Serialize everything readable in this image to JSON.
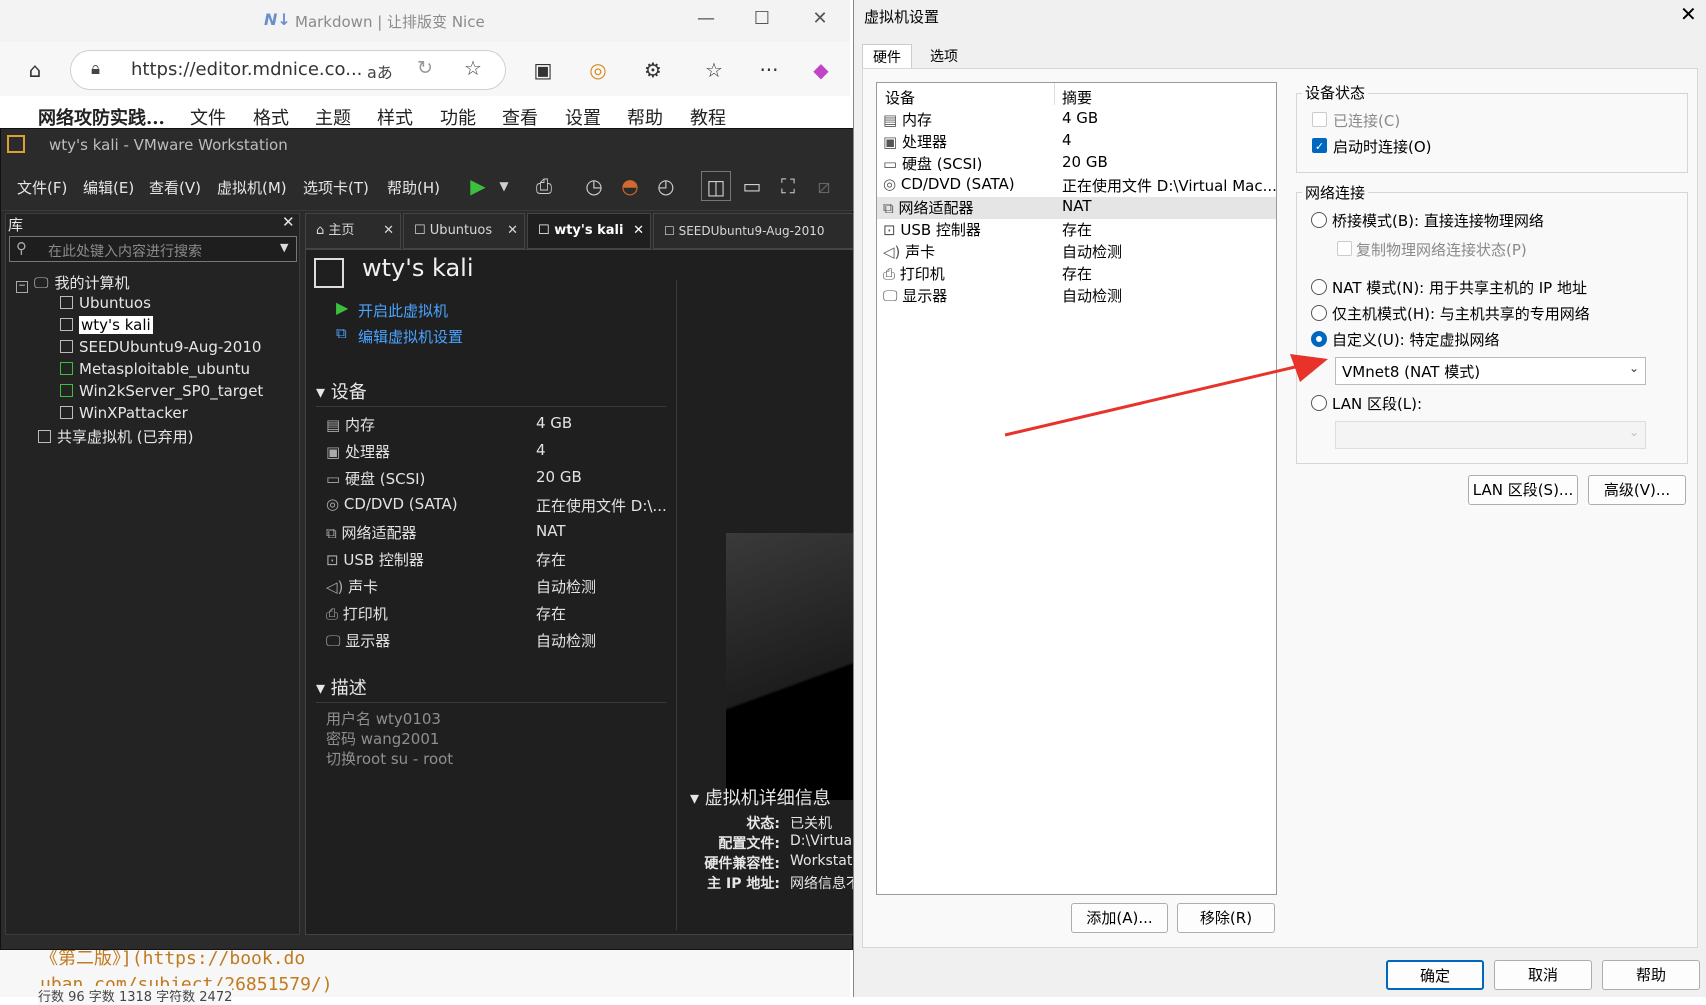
{
  "browser": {
    "title": "Markdown | 让排版变 Nice",
    "url": "https://editor.mdnice.co...",
    "menu": [
      "网络攻防实践...",
      "文件",
      "格式",
      "主题",
      "样式",
      "功能",
      "查看",
      "设置",
      "帮助",
      "教程"
    ],
    "bottom_line1": "《第二版》](https://book.do",
    "bottom_line2": "uban.com/subject/26851579/)",
    "statusbar": "行数 96  字数 1318  字符数 2472"
  },
  "vmware": {
    "title": "wty's kali - VMware Workstation",
    "menu": [
      "文件(F)",
      "编辑(E)",
      "查看(V)",
      "虚拟机(M)",
      "选项卡(T)",
      "帮助(H)"
    ],
    "library_title": "库",
    "search_placeholder": "在此处键入内容进行搜索",
    "tree": {
      "root": "我的计算机",
      "items": [
        "Ubuntuos",
        "wty's kali",
        "SEEDUbuntu9-Aug-2010",
        "Metasploitable_ubuntu",
        "Win2kServer_SP0_target",
        "WinXPattacker"
      ],
      "shared": "共享虚拟机 (已弃用)"
    },
    "tabs": [
      "主页",
      "Ubuntuos",
      "wty's kali",
      "SEEDUbuntu9-Aug-2010"
    ],
    "vm_name": "wty's kali",
    "actions": [
      "开启此虚拟机",
      "编辑虚拟机设置"
    ],
    "devices_title": "设备",
    "devices": [
      {
        "name": "内存",
        "value": "4 GB"
      },
      {
        "name": "处理器",
        "value": "4"
      },
      {
        "name": "硬盘 (SCSI)",
        "value": "20 GB"
      },
      {
        "name": "CD/DVD (SATA)",
        "value": "正在使用文件 D:\\..."
      },
      {
        "name": "网络适配器",
        "value": "NAT"
      },
      {
        "name": "USB 控制器",
        "value": "存在"
      },
      {
        "name": "声卡",
        "value": "自动检测"
      },
      {
        "name": "打印机",
        "value": "存在"
      },
      {
        "name": "显示器",
        "value": "自动检测"
      }
    ],
    "desc_title": "描述",
    "desc_lines": [
      "用户名 wty0103",
      "密码   wang2001",
      "切换root  su - root"
    ],
    "details_title": "虚拟机详细信息",
    "details": [
      {
        "key": "状态:",
        "value": "已关机"
      },
      {
        "key": "配置文件:",
        "value": "D:\\Virtua"
      },
      {
        "key": "硬件兼容性:",
        "value": "Workstat"
      },
      {
        "key": "主 IP 地址:",
        "value": "网络信息不"
      }
    ]
  },
  "dialog": {
    "title": "虚拟机设置",
    "tabs": [
      "硬件",
      "选项"
    ],
    "list_headers": [
      "设备",
      "摘要"
    ],
    "devices": [
      {
        "name": "内存",
        "value": "4 GB"
      },
      {
        "name": "处理器",
        "value": "4"
      },
      {
        "name": "硬盘 (SCSI)",
        "value": "20 GB"
      },
      {
        "name": "CD/DVD (SATA)",
        "value": "正在使用文件 D:\\Virtual Mac..."
      },
      {
        "name": "网络适配器",
        "value": "NAT"
      },
      {
        "name": "USB 控制器",
        "value": "存在"
      },
      {
        "name": "声卡",
        "value": "自动检测"
      },
      {
        "name": "打印机",
        "value": "存在"
      },
      {
        "name": "显示器",
        "value": "自动检测"
      }
    ],
    "selected_device": "网络适配器",
    "add_button": "添加(A)...",
    "remove_button": "移除(R)",
    "device_status_title": "设备状态",
    "connected_label": "已连接(C)",
    "connected": false,
    "connect_on_start_label": "启动时连接(O)",
    "connect_on_start": true,
    "network_title": "网络连接",
    "bridged_label": "桥接模式(B): 直接连接物理网络",
    "replicate_label": "复制物理网络连接状态(P)",
    "nat_label": "NAT 模式(N): 用于共享主机的 IP 地址",
    "hostonly_label": "仅主机模式(H): 与主机共享的专用网络",
    "custom_label": "自定义(U): 特定虚拟网络",
    "custom_value": "VMnet8 (NAT 模式)",
    "lan_label": "LAN 区段(L):",
    "selected_mode": "custom",
    "lan_segments_button": "LAN 区段(S)...",
    "advanced_button": "高级(V)...",
    "ok_button": "确定",
    "cancel_button": "取消",
    "help_button": "帮助",
    "accent": "#0067c0",
    "arrow_color": "#e8332a"
  }
}
